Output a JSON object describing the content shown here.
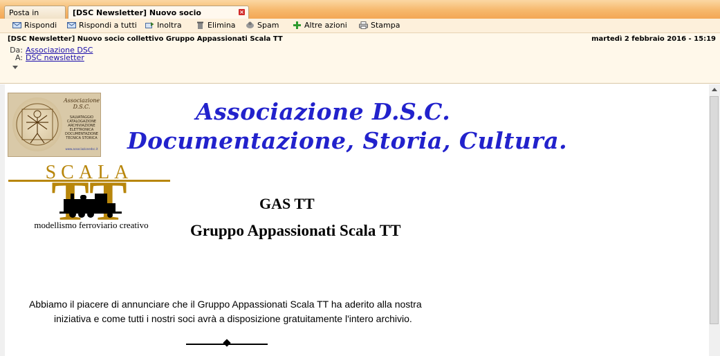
{
  "tabs": [
    {
      "label": "Posta in arrivo"
    },
    {
      "label": "[DSC Newsletter] Nuovo socio collettivo ..."
    }
  ],
  "toolbar": {
    "reply": "Rispondi",
    "reply_all": "Rispondi a tutti",
    "forward": "Inoltra",
    "delete": "Elimina",
    "spam": "Spam",
    "more": "Altre azioni",
    "print": "Stampa"
  },
  "message": {
    "subject": "[DSC Newsletter] Nuovo socio collettivo Gruppo Appassionati Scala TT",
    "date": "martedì 2 febbraio 2016 - 15:19",
    "from_label": "Da:",
    "from": "Associazione DSC",
    "to_label": "A:",
    "to": "DSC newsletter"
  },
  "body": {
    "dsc_logo": {
      "name": "Associazione D.S.C.",
      "lines": "SALVATAGGIO CATALOGAZIONE ARCHIVIAZIONE ELETTRONICA DOCUMENTAZIONE TECNICA STORICA",
      "url": "www.associazionedsc.it"
    },
    "title_line1": "Associazione D.S.C.",
    "title_line2": "Documentazione, Storia, Cultura.",
    "tt_logo": {
      "scala": "SCALA",
      "tt": "TT",
      "tagline": "modellismo ferroviario creativo"
    },
    "gas_title": "GAS TT",
    "gas_subtitle": "Gruppo Appassionati  Scala TT",
    "para_line1": "Abbiamo il piacere di annunciare che il Gruppo Appassionati Scala TT ha aderito alla nostra",
    "para_line2": "iniziativa e come tutti i nostri soci avrà a disposizione gratuitamente l'intero archivio."
  },
  "colors": {
    "title": "#2222cc",
    "tt_gold": "#b8860b",
    "tabbar": "#f6b86c"
  }
}
